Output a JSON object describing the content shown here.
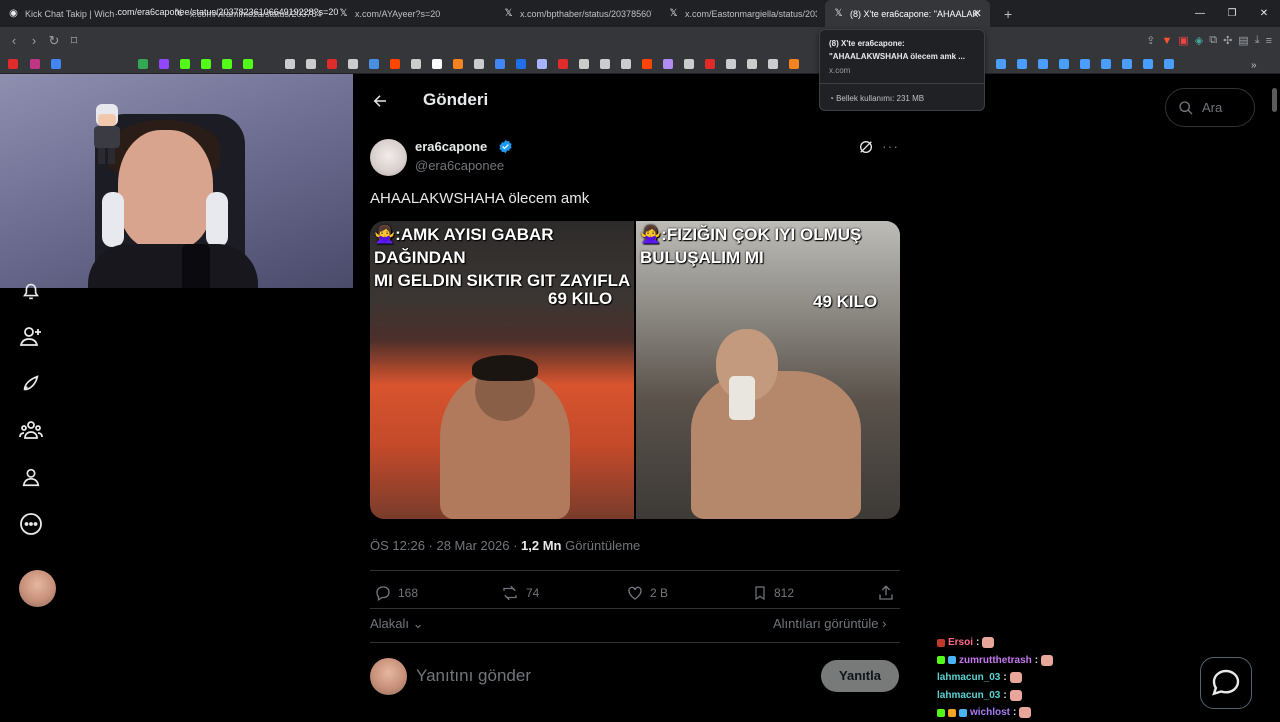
{
  "browser": {
    "tabs": [
      {
        "label": "Kick Chat Takip | Wich",
        "icon": "kick-chat-icon"
      },
      {
        "label": "x.com/viramimoza/status/20378424",
        "icon": "x-logo-icon"
      },
      {
        "label": "x.com/AYAyeer?s=20",
        "icon": "x-logo-icon"
      },
      {
        "label": "x.com/bpthaber/status/20378560739",
        "icon": "x-logo-icon"
      },
      {
        "label": "x.com/Eastonmargiella/status/20378",
        "icon": "x-logo-icon"
      },
      {
        "label": "(8) X'te era6capone: \"AHAALAK",
        "icon": "x-logo-icon",
        "active": true
      }
    ],
    "url": ".com/era6caponee/status/2037823610664919228?s=20",
    "popup": {
      "title": "(8) X'te era6capone: \"AHAALAKWSHAHA ölecem amk ...",
      "domain": "x.com",
      "memory": "Bellek kullanımı: 231 MB"
    }
  },
  "header": {
    "title": "Gönderi"
  },
  "tweet": {
    "display_name": "era6capone",
    "handle": "@era6caponee",
    "text": "AHAALAKWSHAHA ölecem amk",
    "media": {
      "left_caption": "🙅‍♀️:AMK AYISI GABAR DAĞINDAN\nMI GELDIN SIKTIR GIT ZAYIFLA",
      "left_weight": "69 KILO",
      "right_caption": "🙅‍♀️:FIZIĞIN ÇOK IYI OLMUŞ\nBULUŞALIM MI",
      "right_weight": "49 KILO"
    },
    "time": "ÖS 12:26 · 28 Mar 2026 · ",
    "views_count": "1,2 Mn",
    "views_label": " Görüntüleme",
    "stats": {
      "replies": "168",
      "retweets": "74",
      "likes": "2 B",
      "bookmarks": "812"
    },
    "relevance": "Alakalı",
    "quotes_link": "Alıntıları görüntüle"
  },
  "reply": {
    "placeholder": "Yanıtını gönder",
    "button": "Yanıtla"
  },
  "search": {
    "placeholder": "Ara"
  },
  "chat": [
    {
      "user": "Ersoi",
      "color": "#ff6b8b",
      "suffix": " :"
    },
    {
      "user": "zumrutthetrash",
      "color": "#c678f0",
      "suffix": " :"
    },
    {
      "user": "lahmacun_03",
      "color": "#59d2d2",
      "suffix": " :"
    },
    {
      "user": "lahmacun_03",
      "color": "#59d2d2",
      "suffix": " :"
    },
    {
      "user": "wichlost",
      "color": "#a77bf5",
      "suffix": " :"
    }
  ],
  "colors": {
    "background": "#000000",
    "text": "#e7e9ea",
    "muted": "#71767b",
    "verified": "#1d9bf0"
  }
}
